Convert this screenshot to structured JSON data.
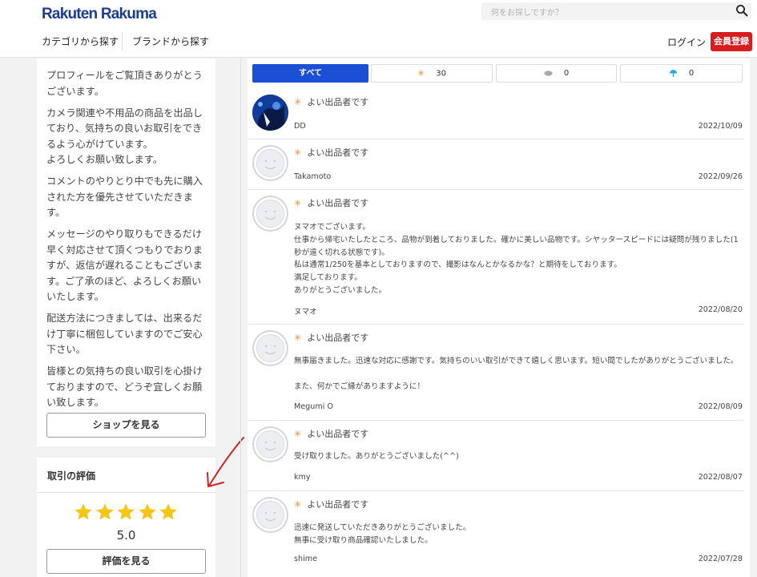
{
  "header": {
    "logo": "Rakuten Rakuma",
    "search_placeholder": "何をお探しですか？",
    "nav": [
      "カテゴリから探す",
      "ブランドから探す"
    ],
    "login": "ログイン",
    "register": "会員登録"
  },
  "profile": {
    "paragraphs": [
      "プロフィールをご覧頂きありがとうございます。",
      "カメラ関連や不用品の商品を出品しており、気持ちの良いお取引をできるよう心がけています。\nよろしくお願い致します。",
      "コメントのやりとり中でも先に購入された方を優先させていただきます。",
      "メッセージのやり取りもできるだけ早く対応させて頂くつもりでおりますが、返信が遅れることもございます。ご了承のほど、よろしくお願いいたします。",
      "配送方法につきましては、出来るだけ丁寧に梱包していますのでご安心下さい。",
      "皆様との気持ちの良い取引を心掛けておりますので、どうぞ宜しくお願い致します。"
    ],
    "shop_button": "ショップを見る"
  },
  "rating": {
    "title": "取引の評価",
    "stars": 5,
    "score": "5.0",
    "button": "評価を見る",
    "star_color": "#f5c518"
  },
  "tabs": [
    {
      "label": "すべて",
      "icon": ""
    },
    {
      "label": "30",
      "icon": "sun-icon"
    },
    {
      "label": "0",
      "icon": "cloud-icon"
    },
    {
      "label": "0",
      "icon": "umbrella-icon"
    }
  ],
  "reviews": [
    {
      "badge": "よい出品者です",
      "body": "",
      "user": "DD",
      "date": "2022/10/09",
      "avatar": "photo"
    },
    {
      "badge": "よい出品者です",
      "body": "",
      "user": "Takamoto",
      "date": "2022/09/26",
      "avatar": "default"
    },
    {
      "badge": "よい出品者です",
      "body": "ヌマオでございます。\n仕事から帰宅いたしたところ、品物が到着しておりました。確かに美しい品物です。シヤッタースピードには疑問が残りました(1秒が遠く切れる状態です)。\n私は通常1/250を基本としておりますので、撮影はなんとかなるかな？と期待をしております。\n満足しております。\nありがとうございました。",
      "user": "ヌマオ",
      "date": "2022/08/20",
      "avatar": "default"
    },
    {
      "badge": "よい出品者です",
      "body": "無事届きました。迅速な対応に感謝です。気持ちのいい取引ができて嬉しく思います。短い間でしたがありがとうございました。\n\nまた、何かでご縁がありますように！",
      "user": "Megumi O",
      "date": "2022/08/09",
      "avatar": "default"
    },
    {
      "badge": "よい出品者です",
      "body": "受け取りました。ありがとうございました(^^)",
      "user": "kmy",
      "date": "2022/08/07",
      "avatar": "default"
    },
    {
      "badge": "よい出品者です",
      "body": "迅速に発送していただきありがとうございました。\n無事に受け取り商品確認いたしました。",
      "user": "shime",
      "date": "2022/07/28",
      "avatar": "default"
    }
  ],
  "colors": {
    "brand": "#1d3c8f",
    "accent": "#1a4fd6",
    "register": "#d71d1d",
    "sun": "#f08a1c",
    "arrow": "#d32020"
  }
}
